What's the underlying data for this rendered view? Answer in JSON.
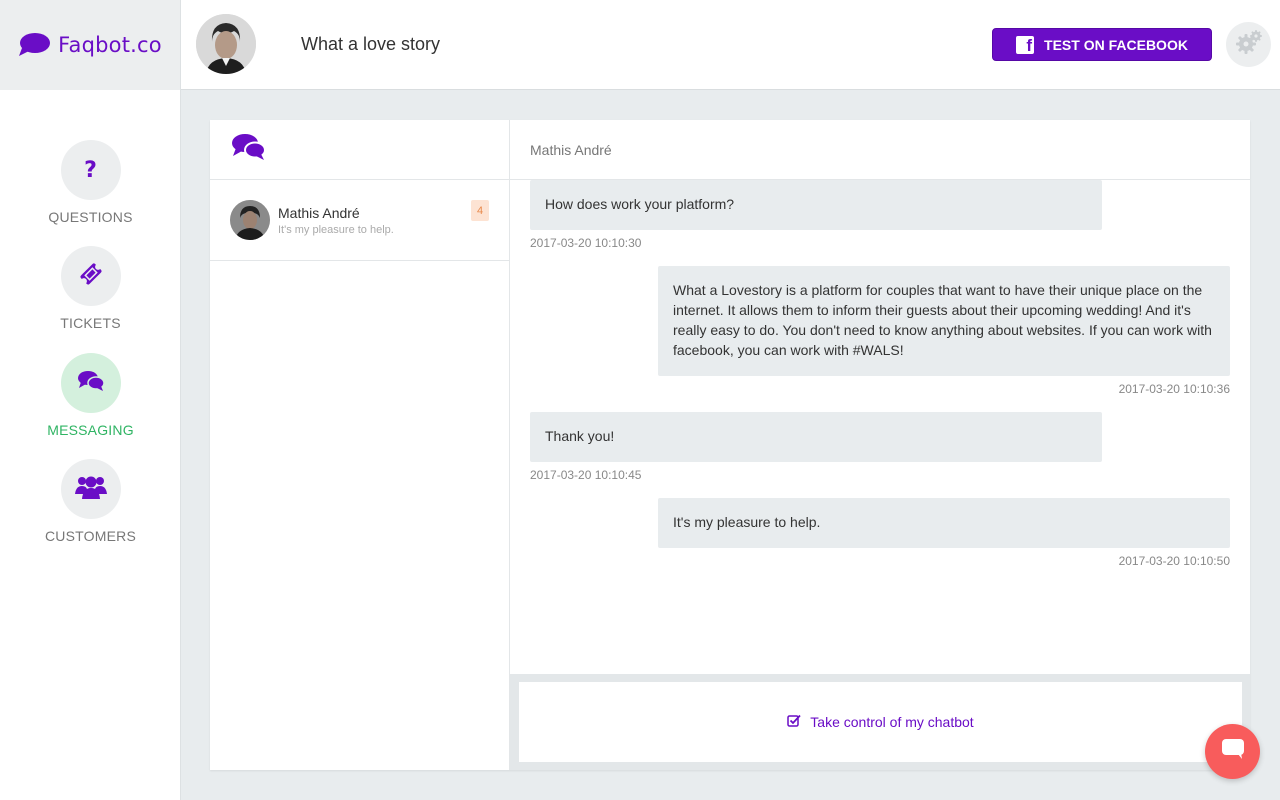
{
  "brand": {
    "name": "Faqbot.co",
    "logo_icon": "speech-bubble-icon",
    "color": "#6a0dc6"
  },
  "header": {
    "bot_name": "What a love story",
    "test_button_label": "TEST ON FACEBOOK",
    "test_button_icon": "facebook-icon",
    "settings_icon": "gears-icon"
  },
  "sidebar": {
    "items": [
      {
        "label": "QUESTIONS",
        "icon": "question-mark-icon",
        "active": false
      },
      {
        "label": "TICKETS",
        "icon": "ticket-icon",
        "active": false
      },
      {
        "label": "MESSAGING",
        "icon": "comments-icon",
        "active": true
      },
      {
        "label": "CUSTOMERS",
        "icon": "users-icon",
        "active": false
      }
    ],
    "active_color": "#2fb463"
  },
  "conversations": {
    "header_icon": "comments-icon",
    "items": [
      {
        "name": "Mathis André",
        "preview": "It's my pleasure to help.",
        "unread": "4"
      }
    ]
  },
  "chat": {
    "contact_name": "Mathis André",
    "messages": [
      {
        "direction": "in",
        "text": "How does work your platform?",
        "timestamp": "2017-03-20 10:10:30"
      },
      {
        "direction": "out",
        "text": "What a Lovestory is a platform for couples that want to have their unique place on the internet. It allows them to inform their guests about their upcoming wedding! And it's really easy to do. You don't need to know anything about websites. If you can work with facebook, you can work with #WALS!",
        "timestamp": "2017-03-20 10:10:36"
      },
      {
        "direction": "in",
        "text": "Thank you!",
        "timestamp": "2017-03-20 10:10:45"
      },
      {
        "direction": "out",
        "text": "It's my pleasure to help.",
        "timestamp": "2017-03-20 10:10:50"
      }
    ],
    "take_control_label": "Take control of my chatbot",
    "take_control_icon": "checkbox-icon"
  },
  "fab": {
    "icon": "chat-bubble-icon",
    "color": "#f85c5c"
  }
}
